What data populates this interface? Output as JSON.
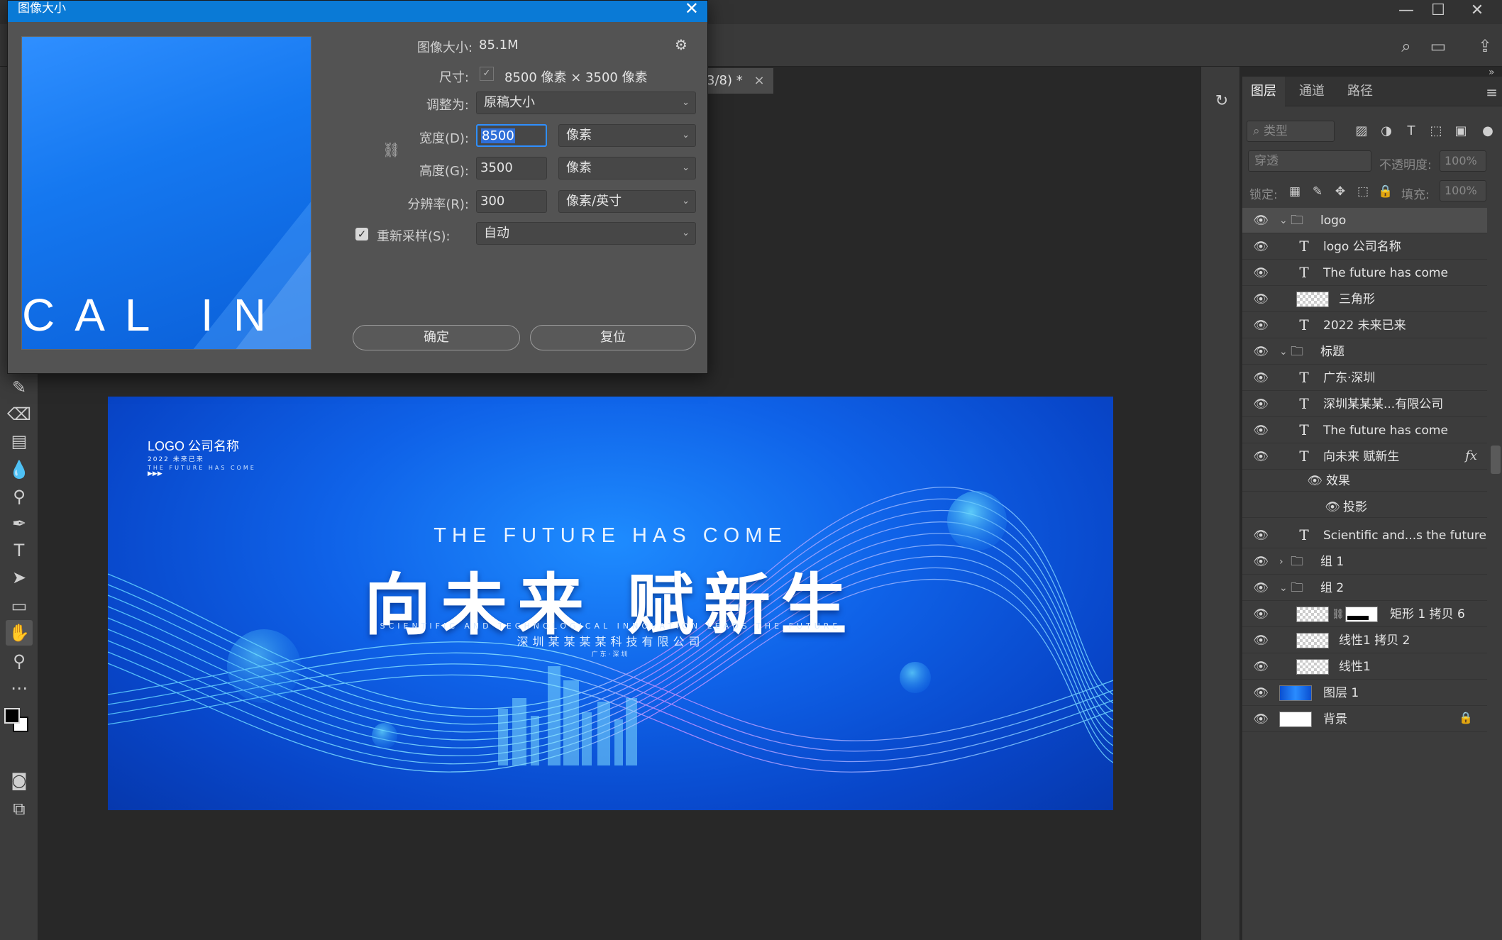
{
  "app": {
    "window_controls": [
      "—",
      "☐",
      "✕"
    ]
  },
  "document_tab": {
    "label": "3/8) *",
    "close": "×"
  },
  "dialog": {
    "title": "图像大小",
    "close": "✕",
    "preview_text": "CAL IN",
    "image_size_label": "图像大小:",
    "image_size_value": "85.1M",
    "dimensions_label": "尺寸:",
    "dimensions_value": "8500 像素  ×  3500 像素",
    "fit_to_label": "调整为:",
    "fit_to_value": "原稿大小",
    "width_label": "宽度(D):",
    "width_value": "8500",
    "width_unit": "像素",
    "height_label": "高度(G):",
    "height_value": "3500",
    "height_unit": "像素",
    "resolution_label": "分辨率(R):",
    "resolution_value": "300",
    "resolution_unit": "像素/英寸",
    "resample_label": "重新采样(S):",
    "resample_checked": true,
    "resample_value": "自动",
    "ok_label": "确定",
    "reset_label": "复位"
  },
  "artwork": {
    "logo": "LOGO  公司名称",
    "logo_sub": "2022  未来已来",
    "logo_sub2": "THE FUTURE HAS COME",
    "logo_arrows": "▶▶▶",
    "future_line": "THE FUTURE HAS COME",
    "main_title": "向未来  赋新生",
    "science_line": "SCIENTIFIC AND TECHNOLOGICAL INNOVATION LEADS THE FUTURE",
    "company": "深圳某某某某科技有限公司",
    "place": "广东·深圳",
    "colors": {
      "bg_light": "#1e8cff",
      "bg_dark": "#0638ad",
      "wave": "#7fd2ff",
      "wave_purple": "#c48cff"
    }
  },
  "layers_panel": {
    "tabs": [
      "图层",
      "通道",
      "路径"
    ],
    "filter_placeholder": "类型",
    "blend_mode": "穿透",
    "opacity_label": "不透明度:",
    "opacity_value": "100%",
    "lock_label": "锁定:",
    "fill_label": "填充:",
    "fill_value": "100%",
    "layers": [
      {
        "name": "logo",
        "kind": "group",
        "expanded": true,
        "indent": 0,
        "selected": true
      },
      {
        "name": "logo  公司名称",
        "kind": "text",
        "indent": 1
      },
      {
        "name": "The future has come",
        "kind": "text",
        "indent": 1
      },
      {
        "name": "三角形",
        "kind": "pixel",
        "indent": 1
      },
      {
        "name": "2022   未来已来",
        "kind": "text",
        "indent": 1
      },
      {
        "name": "标题",
        "kind": "group",
        "expanded": true,
        "indent": 0
      },
      {
        "name": "广东·深圳",
        "kind": "text",
        "indent": 1
      },
      {
        "name": "深圳某某某...有限公司",
        "kind": "text",
        "indent": 1
      },
      {
        "name": "The future has come",
        "kind": "text",
        "indent": 1
      },
      {
        "name": "向未来 赋新生",
        "kind": "text",
        "indent": 1,
        "fx": "fx"
      },
      {
        "name": "效果",
        "kind": "effect",
        "indent": 2
      },
      {
        "name": "投影",
        "kind": "effect",
        "indent": 3
      },
      {
        "name": "Scientific and...s the future",
        "kind": "text",
        "indent": 1
      },
      {
        "name": "组 1",
        "kind": "group",
        "expanded": false,
        "indent": 0
      },
      {
        "name": "组 2",
        "kind": "group",
        "expanded": true,
        "indent": 0
      },
      {
        "name": "矩形 1 拷贝 6",
        "kind": "masked",
        "indent": 1
      },
      {
        "name": "线性1 拷贝 2",
        "kind": "pixel",
        "indent": 1
      },
      {
        "name": "线性1",
        "kind": "pixel",
        "indent": 1
      },
      {
        "name": "图层 1",
        "kind": "image",
        "indent": 0
      },
      {
        "name": "背景",
        "kind": "background",
        "indent": 0,
        "locked": true
      }
    ]
  }
}
